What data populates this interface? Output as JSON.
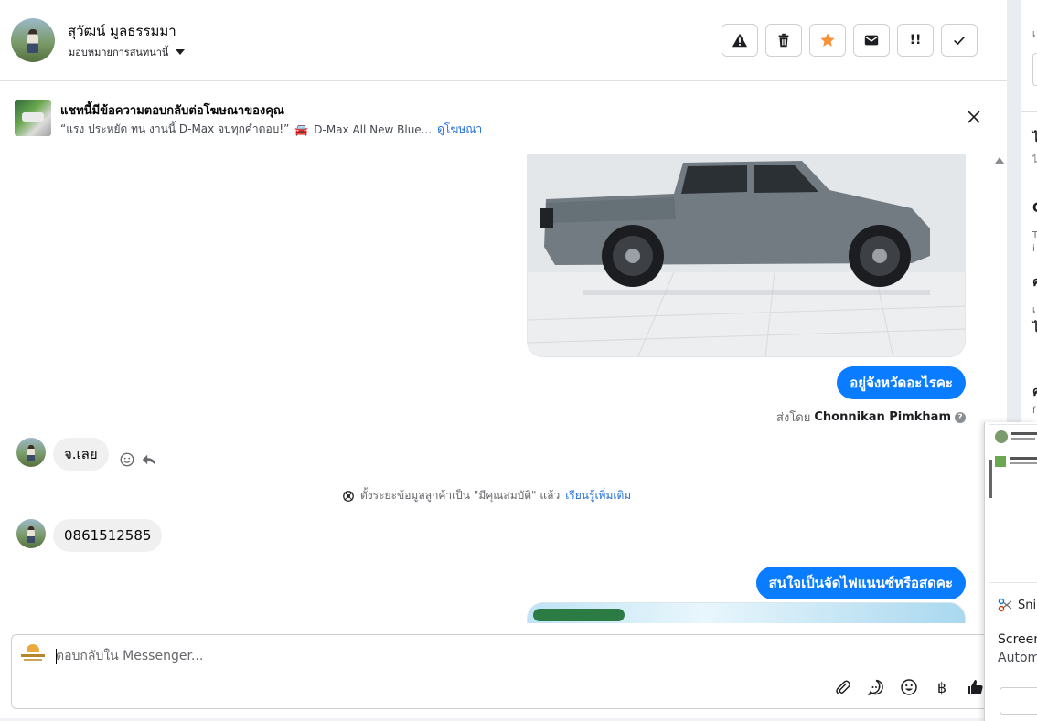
{
  "header": {
    "contact_name": "สุวัฒน์ มูลธรรมมา",
    "assign_label": "มอบหมายการสนทนานี้",
    "tools": [
      {
        "name": "report-spam-button",
        "icon": "warning-icon"
      },
      {
        "name": "delete-button",
        "icon": "trash-icon"
      },
      {
        "name": "star-button",
        "icon": "star-icon"
      },
      {
        "name": "mark-unread-button",
        "icon": "envelope-icon"
      },
      {
        "name": "follow-up-button",
        "icon": "follow-up-icon",
        "text": "!!"
      },
      {
        "name": "mark-done-button",
        "icon": "check-icon"
      }
    ],
    "star_color": "#f7923a"
  },
  "ad_banner": {
    "title": "แชทนี้มีข้อความตอบกลับต่อโฆษณาของคุณ",
    "quote": "“แรง ประหยัด ทน งานนี้ D-Max จบทุกคำตอบ!”",
    "car_emoji": "🚘",
    "ad_name": "D-Max All New Blue...",
    "view_ad_link": "ดูโฆษณา"
  },
  "messages": {
    "outgoing_1": "อยู่จังหวัดอะไรคะ",
    "sent_by_prefix": "ส่งโดย",
    "sent_by_name": "Chonnikan Pimkham",
    "incoming_1": "จ.เลย",
    "system_note": "ตั้งระยะข้อมูลลูกค้าเป็น \"มีคุณสมบัติ\" แล้ว",
    "system_link": "เรียนรู้เพิ่มเติม",
    "incoming_2": "0861512585",
    "outgoing_2": "สนใจเป็นจัดไฟแนนซ์หรือสดคะ",
    "accent_color": "#0a7cff"
  },
  "composer": {
    "placeholder": "ตอบกลับใน Messenger...",
    "tools": [
      "attach-icon",
      "saved-reply-icon",
      "emoji-icon",
      "baht-icon",
      "like-icon"
    ],
    "baht_symbol": "฿"
  },
  "snip_notification": {
    "app_name": "Snip",
    "title": "Screen",
    "subtitle": "Autom"
  }
}
